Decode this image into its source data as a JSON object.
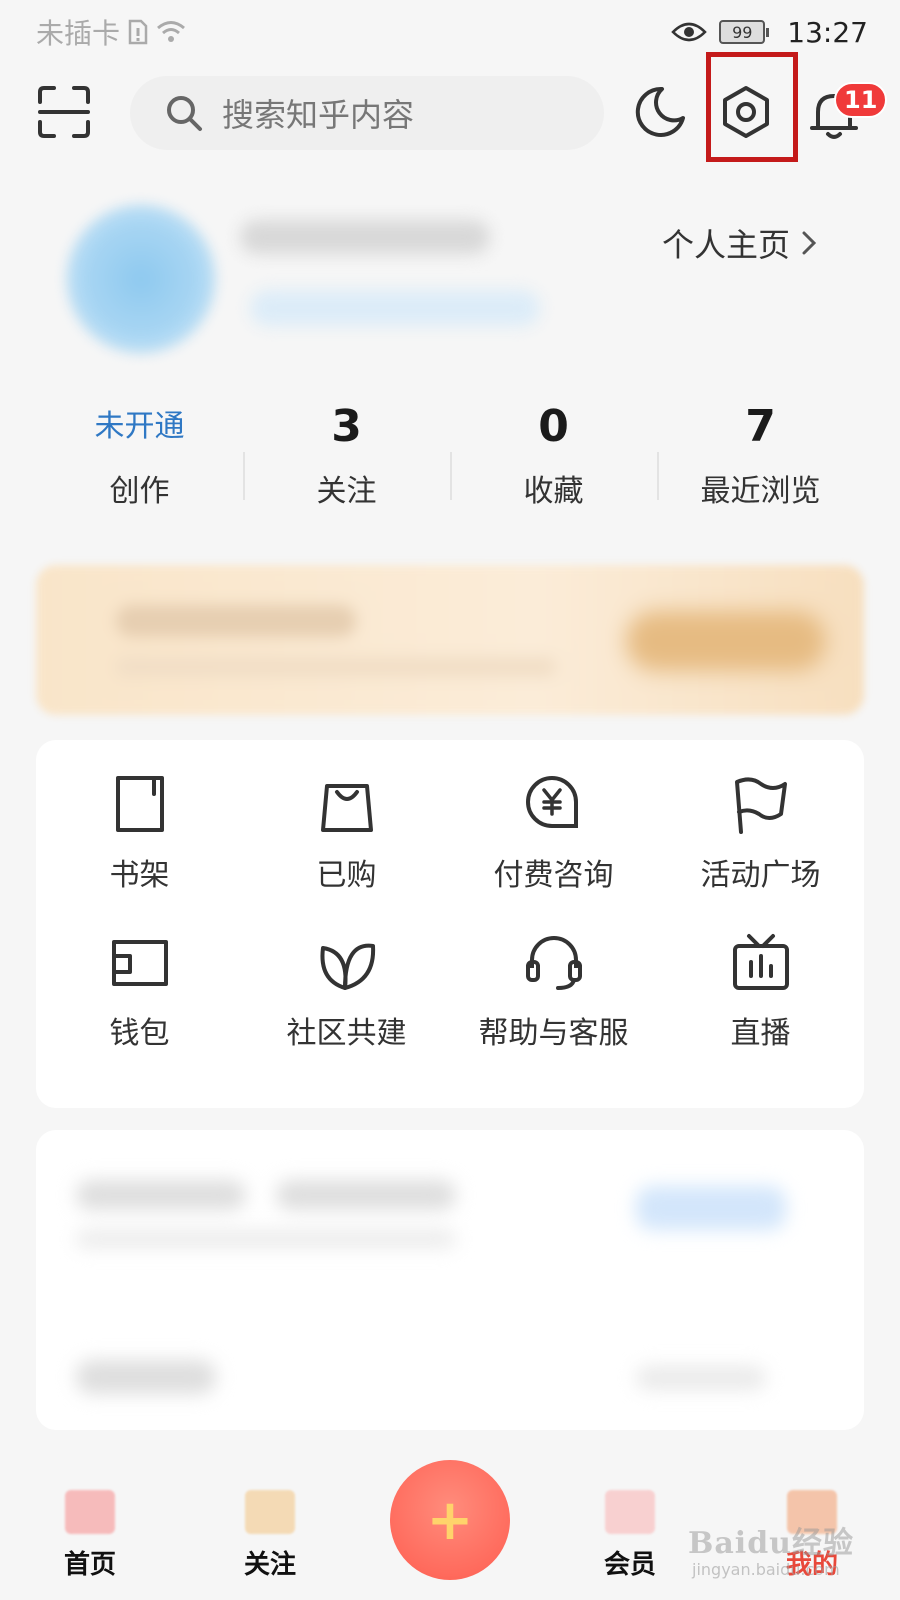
{
  "status_bar": {
    "carrier": "未插卡",
    "battery": "99",
    "time": "13:27"
  },
  "top_bar": {
    "search_placeholder": "搜索知乎内容",
    "notification_count": "11"
  },
  "profile": {
    "homepage_link": "个人主页"
  },
  "stats": [
    {
      "value": "未开通",
      "label": "创作"
    },
    {
      "value": "3",
      "label": "关注"
    },
    {
      "value": "0",
      "label": "收藏"
    },
    {
      "value": "7",
      "label": "最近浏览"
    }
  ],
  "tools": [
    {
      "label": "书架",
      "icon": "bookshelf-icon"
    },
    {
      "label": "已购",
      "icon": "shopping-bag-icon"
    },
    {
      "label": "付费咨询",
      "icon": "paid-consult-icon"
    },
    {
      "label": "活动广场",
      "icon": "flag-icon"
    },
    {
      "label": "钱包",
      "icon": "wallet-icon"
    },
    {
      "label": "社区共建",
      "icon": "leaves-icon"
    },
    {
      "label": "帮助与客服",
      "icon": "headset-icon"
    },
    {
      "label": "直播",
      "icon": "tv-icon"
    }
  ],
  "tab_bar": {
    "items": [
      {
        "label": "首页"
      },
      {
        "label": "关注"
      },
      {
        "label": "会员"
      },
      {
        "label": "我的"
      }
    ],
    "fab_symbol": "+"
  },
  "watermark": {
    "text": "Baidu经验",
    "sub": "jingyan.baidu.com"
  },
  "colors": {
    "highlight": "#c41a1a",
    "badge": "#f03a3a",
    "link_blue": "#2f78c4",
    "active_tab": "#e8483a"
  }
}
